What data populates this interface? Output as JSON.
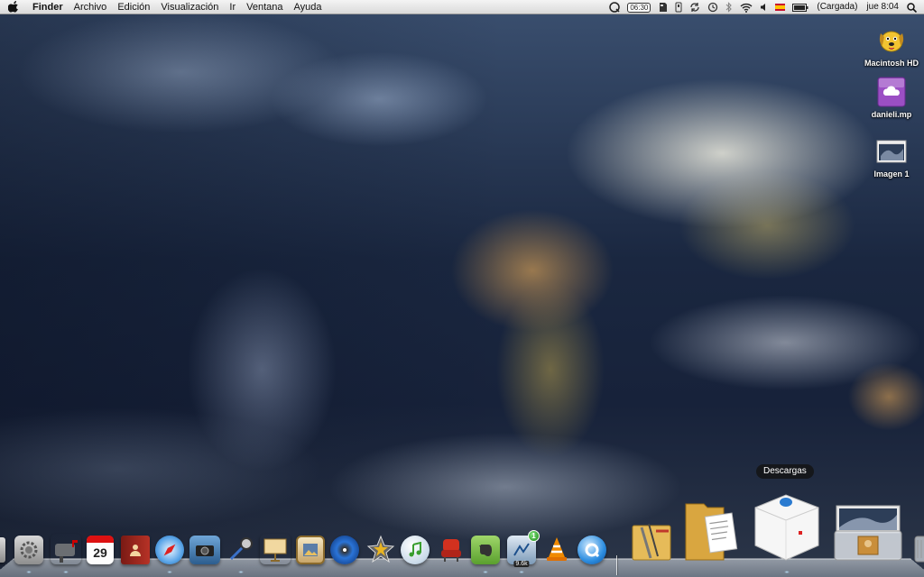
{
  "menubar": {
    "app_name": "Finder",
    "menus": [
      "Archivo",
      "Edición",
      "Visualización",
      "Ir",
      "Ventana",
      "Ayuda"
    ],
    "status": {
      "timer": "06:30",
      "battery": "(Cargada)",
      "clock": "jue 8:04"
    }
  },
  "desktop": {
    "icons": [
      {
        "label": "Macintosh HD",
        "icon": "dog-hard-drive-icon"
      },
      {
        "label": "danieli.mp",
        "icon": "idisk-cloud-icon"
      },
      {
        "label": "Imagen 1",
        "icon": "screenshot-file-icon"
      }
    ]
  },
  "dock": {
    "tooltip": "Descargas",
    "calendar_day": "29",
    "notification_count": "1",
    "speed_label": "9.6k",
    "apps": [
      "system-preferences",
      "mail",
      "ical",
      "address-book",
      "safari",
      "iphoto",
      "preview",
      "keynote",
      "iphoto-slideshow",
      "dvd-player",
      "imovie",
      "itunes",
      "front-row",
      "evernote",
      "network-monitor",
      "vlc",
      "quicktime"
    ],
    "stacks": [
      "applications-stack",
      "documents-stack",
      "downloads-stack",
      "screenshots-stack",
      "trash"
    ]
  },
  "colors": {
    "menubar_top": "#f4f4f4",
    "menubar_bottom": "#dadada",
    "tooltip_bg": "#141414"
  }
}
